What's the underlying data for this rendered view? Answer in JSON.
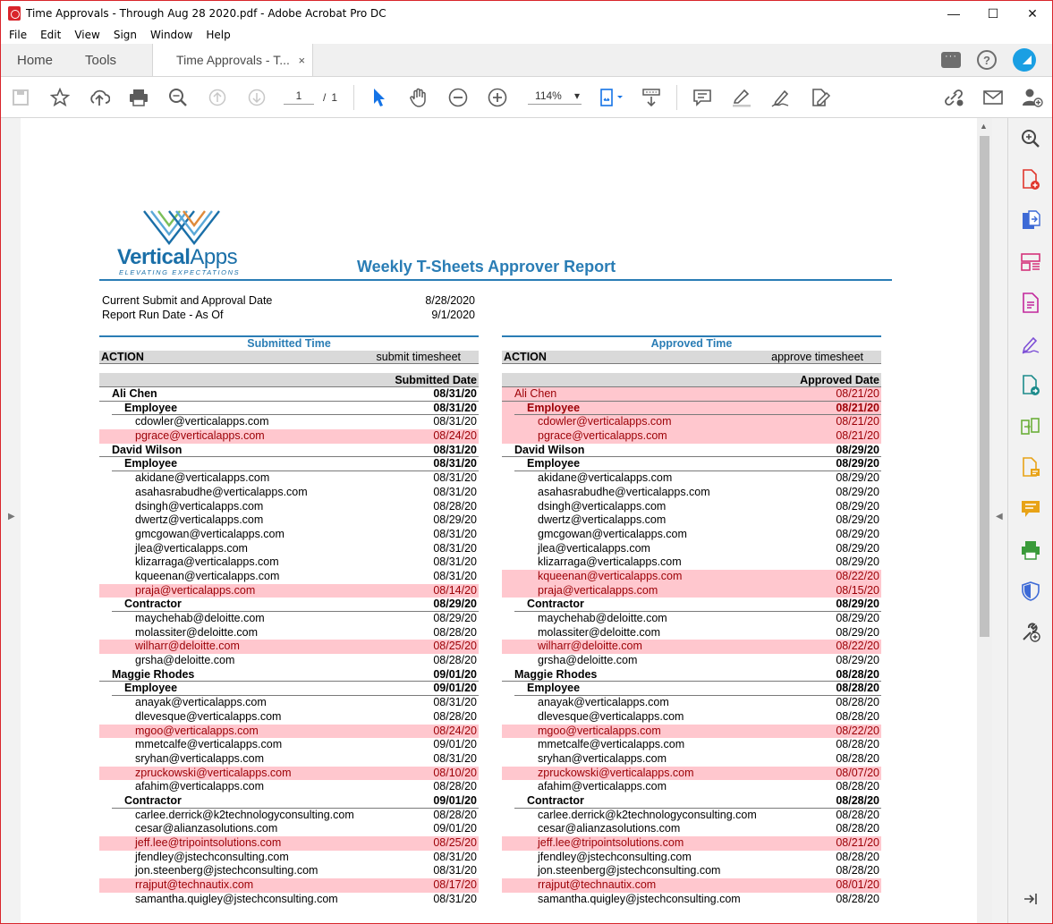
{
  "window": {
    "title": "Time Approvals - Through Aug 28 2020.pdf - Adobe Acrobat Pro DC",
    "minimize": "—",
    "maximize": "☐",
    "close": "✕"
  },
  "menu": [
    "File",
    "Edit",
    "View",
    "Sign",
    "Window",
    "Help"
  ],
  "tabs": {
    "home": "Home",
    "tools": "Tools",
    "doc": "Time Approvals - T...",
    "doc_close": "×"
  },
  "toolbar": {
    "page_current": "1",
    "page_sep": "/",
    "page_total": "1",
    "zoom": "114%",
    "zoom_arrow": "▾"
  },
  "icons": {
    "save": "save-icon",
    "bookmark": "star-icon",
    "upload": "cloud-upload-icon",
    "print": "printer-icon",
    "find": "search-icon",
    "prev": "arrow-up-icon",
    "next": "arrow-down-icon",
    "select": "cursor-icon",
    "hand": "hand-icon",
    "zoom_out": "zoom-out-icon",
    "zoom_in": "zoom-in-icon"
  },
  "report": {
    "brand_bold": "Vertical",
    "brand_light": "Apps",
    "tagline": "ELEVATING EXPECTATIONS",
    "title": "Weekly T-Sheets Approver Report",
    "meta": [
      {
        "label": "Current Submit and Approval Date",
        "value": "8/28/2020"
      },
      {
        "label": "Report Run Date - As Of",
        "value": "9/1/2020"
      }
    ],
    "submitted": {
      "heading": "Submitted Time",
      "action_label": "ACTION",
      "action_value": "submit timesheet",
      "date_header": "Submitted Date",
      "rows": [
        {
          "label": "Ali Chen",
          "date": "08/31/20",
          "level": 0,
          "bold": true,
          "red": false,
          "rule": "full"
        },
        {
          "label": "Employee",
          "date": "08/31/20",
          "level": 1,
          "bold": true,
          "red": false,
          "rule": "sub"
        },
        {
          "label": "cdowler@verticalapps.com",
          "date": "08/31/20",
          "level": 2,
          "bold": false,
          "red": false
        },
        {
          "label": "pgrace@verticalapps.com",
          "date": "08/24/20",
          "level": 2,
          "bold": false,
          "red": true
        },
        {
          "label": "David Wilson",
          "date": "08/31/20",
          "level": 0,
          "bold": true,
          "red": false,
          "rule": "full"
        },
        {
          "label": "Employee",
          "date": "08/31/20",
          "level": 1,
          "bold": true,
          "red": false,
          "rule": "sub"
        },
        {
          "label": "akidane@verticalapps.com",
          "date": "08/31/20",
          "level": 2,
          "bold": false,
          "red": false
        },
        {
          "label": "asahasrabudhe@verticalapps.com",
          "date": "08/31/20",
          "level": 2,
          "bold": false,
          "red": false
        },
        {
          "label": "dsingh@verticalapps.com",
          "date": "08/28/20",
          "level": 2,
          "bold": false,
          "red": false
        },
        {
          "label": "dwertz@verticalapps.com",
          "date": "08/29/20",
          "level": 2,
          "bold": false,
          "red": false
        },
        {
          "label": "gmcgowan@verticalapps.com",
          "date": "08/31/20",
          "level": 2,
          "bold": false,
          "red": false
        },
        {
          "label": "jlea@verticalapps.com",
          "date": "08/31/20",
          "level": 2,
          "bold": false,
          "red": false
        },
        {
          "label": "klizarraga@verticalapps.com",
          "date": "08/31/20",
          "level": 2,
          "bold": false,
          "red": false
        },
        {
          "label": "kqueenan@verticalapps.com",
          "date": "08/31/20",
          "level": 2,
          "bold": false,
          "red": false
        },
        {
          "label": "praja@verticalapps.com",
          "date": "08/14/20",
          "level": 2,
          "bold": false,
          "red": true
        },
        {
          "label": "Contractor",
          "date": "08/29/20",
          "level": 1,
          "bold": true,
          "red": false,
          "rule": "sub"
        },
        {
          "label": "maychehab@deloitte.com",
          "date": "08/29/20",
          "level": 2,
          "bold": false,
          "red": false
        },
        {
          "label": "molassiter@deloitte.com",
          "date": "08/28/20",
          "level": 2,
          "bold": false,
          "red": false
        },
        {
          "label": "wilharr@deloitte.com",
          "date": "08/25/20",
          "level": 2,
          "bold": false,
          "red": true
        },
        {
          "label": "grsha@deloitte.com",
          "date": "08/28/20",
          "level": 2,
          "bold": false,
          "red": false
        },
        {
          "label": "Maggie Rhodes",
          "date": "09/01/20",
          "level": 0,
          "bold": true,
          "red": false,
          "rule": "full"
        },
        {
          "label": "Employee",
          "date": "09/01/20",
          "level": 1,
          "bold": true,
          "red": false,
          "rule": "sub"
        },
        {
          "label": "anayak@verticalapps.com",
          "date": "08/31/20",
          "level": 2,
          "bold": false,
          "red": false
        },
        {
          "label": "dlevesque@verticalapps.com",
          "date": "08/28/20",
          "level": 2,
          "bold": false,
          "red": false
        },
        {
          "label": "mgoo@verticalapps.com",
          "date": "08/24/20",
          "level": 2,
          "bold": false,
          "red": true
        },
        {
          "label": "mmetcalfe@verticalapps.com",
          "date": "09/01/20",
          "level": 2,
          "bold": false,
          "red": false
        },
        {
          "label": "sryhan@verticalapps.com",
          "date": "08/31/20",
          "level": 2,
          "bold": false,
          "red": false
        },
        {
          "label": "zpruckowski@verticalapps.com",
          "date": "08/10/20",
          "level": 2,
          "bold": false,
          "red": true
        },
        {
          "label": "afahim@verticalapps.com",
          "date": "08/28/20",
          "level": 2,
          "bold": false,
          "red": false
        },
        {
          "label": "Contractor",
          "date": "09/01/20",
          "level": 1,
          "bold": true,
          "red": false,
          "rule": "sub"
        },
        {
          "label": "carlee.derrick@k2technologyconsulting.com",
          "date": "08/28/20",
          "level": 2,
          "bold": false,
          "red": false
        },
        {
          "label": "cesar@alianzasolutions.com",
          "date": "09/01/20",
          "level": 2,
          "bold": false,
          "red": false
        },
        {
          "label": "jeff.lee@tripointsolutions.com",
          "date": "08/25/20",
          "level": 2,
          "bold": false,
          "red": true
        },
        {
          "label": "jfendley@jstechconsulting.com",
          "date": "08/31/20",
          "level": 2,
          "bold": false,
          "red": false
        },
        {
          "label": "jon.steenberg@jstechconsulting.com",
          "date": "08/31/20",
          "level": 2,
          "bold": false,
          "red": false
        },
        {
          "label": "rrajput@technautix.com",
          "date": "08/17/20",
          "level": 2,
          "bold": false,
          "red": true
        },
        {
          "label": "samantha.quigley@jstechconsulting.com",
          "date": "08/31/20",
          "level": 2,
          "bold": false,
          "red": false
        }
      ]
    },
    "approved": {
      "heading": "Approved Time",
      "action_label": "ACTION",
      "action_value": "approve timesheet",
      "date_header": "Approved Date",
      "rows": [
        {
          "label": "Ali Chen",
          "date": "08/21/20",
          "level": 0,
          "bold": false,
          "red": true,
          "rule": "full"
        },
        {
          "label": "Employee",
          "date": "08/21/20",
          "level": 1,
          "bold": true,
          "red": true,
          "rule": "sub"
        },
        {
          "label": "cdowler@verticalapps.com",
          "date": "08/21/20",
          "level": 2,
          "bold": false,
          "red": true
        },
        {
          "label": "pgrace@verticalapps.com",
          "date": "08/21/20",
          "level": 2,
          "bold": false,
          "red": true
        },
        {
          "label": "David Wilson",
          "date": "08/29/20",
          "level": 0,
          "bold": true,
          "red": false,
          "rule": "full"
        },
        {
          "label": "Employee",
          "date": "08/29/20",
          "level": 1,
          "bold": true,
          "red": false,
          "rule": "sub"
        },
        {
          "label": "akidane@verticalapps.com",
          "date": "08/29/20",
          "level": 2,
          "bold": false,
          "red": false
        },
        {
          "label": "asahasrabudhe@verticalapps.com",
          "date": "08/29/20",
          "level": 2,
          "bold": false,
          "red": false
        },
        {
          "label": "dsingh@verticalapps.com",
          "date": "08/29/20",
          "level": 2,
          "bold": false,
          "red": false
        },
        {
          "label": "dwertz@verticalapps.com",
          "date": "08/29/20",
          "level": 2,
          "bold": false,
          "red": false
        },
        {
          "label": "gmcgowan@verticalapps.com",
          "date": "08/29/20",
          "level": 2,
          "bold": false,
          "red": false
        },
        {
          "label": "jlea@verticalapps.com",
          "date": "08/29/20",
          "level": 2,
          "bold": false,
          "red": false
        },
        {
          "label": "klizarraga@verticalapps.com",
          "date": "08/29/20",
          "level": 2,
          "bold": false,
          "red": false
        },
        {
          "label": "kqueenan@verticalapps.com",
          "date": "08/22/20",
          "level": 2,
          "bold": false,
          "red": true
        },
        {
          "label": "praja@verticalapps.com",
          "date": "08/15/20",
          "level": 2,
          "bold": false,
          "red": true
        },
        {
          "label": "Contractor",
          "date": "08/29/20",
          "level": 1,
          "bold": true,
          "red": false,
          "rule": "sub"
        },
        {
          "label": "maychehab@deloitte.com",
          "date": "08/29/20",
          "level": 2,
          "bold": false,
          "red": false
        },
        {
          "label": "molassiter@deloitte.com",
          "date": "08/29/20",
          "level": 2,
          "bold": false,
          "red": false
        },
        {
          "label": "wilharr@deloitte.com",
          "date": "08/22/20",
          "level": 2,
          "bold": false,
          "red": true
        },
        {
          "label": "grsha@deloitte.com",
          "date": "08/29/20",
          "level": 2,
          "bold": false,
          "red": false
        },
        {
          "label": "Maggie Rhodes",
          "date": "08/28/20",
          "level": 0,
          "bold": true,
          "red": false,
          "rule": "full"
        },
        {
          "label": "Employee",
          "date": "08/28/20",
          "level": 1,
          "bold": true,
          "red": false,
          "rule": "sub"
        },
        {
          "label": "anayak@verticalapps.com",
          "date": "08/28/20",
          "level": 2,
          "bold": false,
          "red": false
        },
        {
          "label": "dlevesque@verticalapps.com",
          "date": "08/28/20",
          "level": 2,
          "bold": false,
          "red": false
        },
        {
          "label": "mgoo@verticalapps.com",
          "date": "08/22/20",
          "level": 2,
          "bold": false,
          "red": true
        },
        {
          "label": "mmetcalfe@verticalapps.com",
          "date": "08/28/20",
          "level": 2,
          "bold": false,
          "red": false
        },
        {
          "label": "sryhan@verticalapps.com",
          "date": "08/28/20",
          "level": 2,
          "bold": false,
          "red": false
        },
        {
          "label": "zpruckowski@verticalapps.com",
          "date": "08/07/20",
          "level": 2,
          "bold": false,
          "red": true
        },
        {
          "label": "afahim@verticalapps.com",
          "date": "08/28/20",
          "level": 2,
          "bold": false,
          "red": false
        },
        {
          "label": "Contractor",
          "date": "08/28/20",
          "level": 1,
          "bold": true,
          "red": false,
          "rule": "sub"
        },
        {
          "label": "carlee.derrick@k2technologyconsulting.com",
          "date": "08/28/20",
          "level": 2,
          "bold": false,
          "red": false
        },
        {
          "label": "cesar@alianzasolutions.com",
          "date": "08/28/20",
          "level": 2,
          "bold": false,
          "red": false
        },
        {
          "label": "jeff.lee@tripointsolutions.com",
          "date": "08/21/20",
          "level": 2,
          "bold": false,
          "red": true
        },
        {
          "label": "jfendley@jstechconsulting.com",
          "date": "08/28/20",
          "level": 2,
          "bold": false,
          "red": false
        },
        {
          "label": "jon.steenberg@jstechconsulting.com",
          "date": "08/28/20",
          "level": 2,
          "bold": false,
          "red": false
        },
        {
          "label": "rrajput@technautix.com",
          "date": "08/01/20",
          "level": 2,
          "bold": false,
          "red": true
        },
        {
          "label": "samantha.quigley@jstechconsulting.com",
          "date": "08/28/20",
          "level": 2,
          "bold": false,
          "red": false
        }
      ]
    }
  },
  "colors": {
    "accent": "#2a7db5",
    "red_fill": "#ffc7ce",
    "red_text": "#9c0006",
    "window_border": "#d9252b"
  }
}
